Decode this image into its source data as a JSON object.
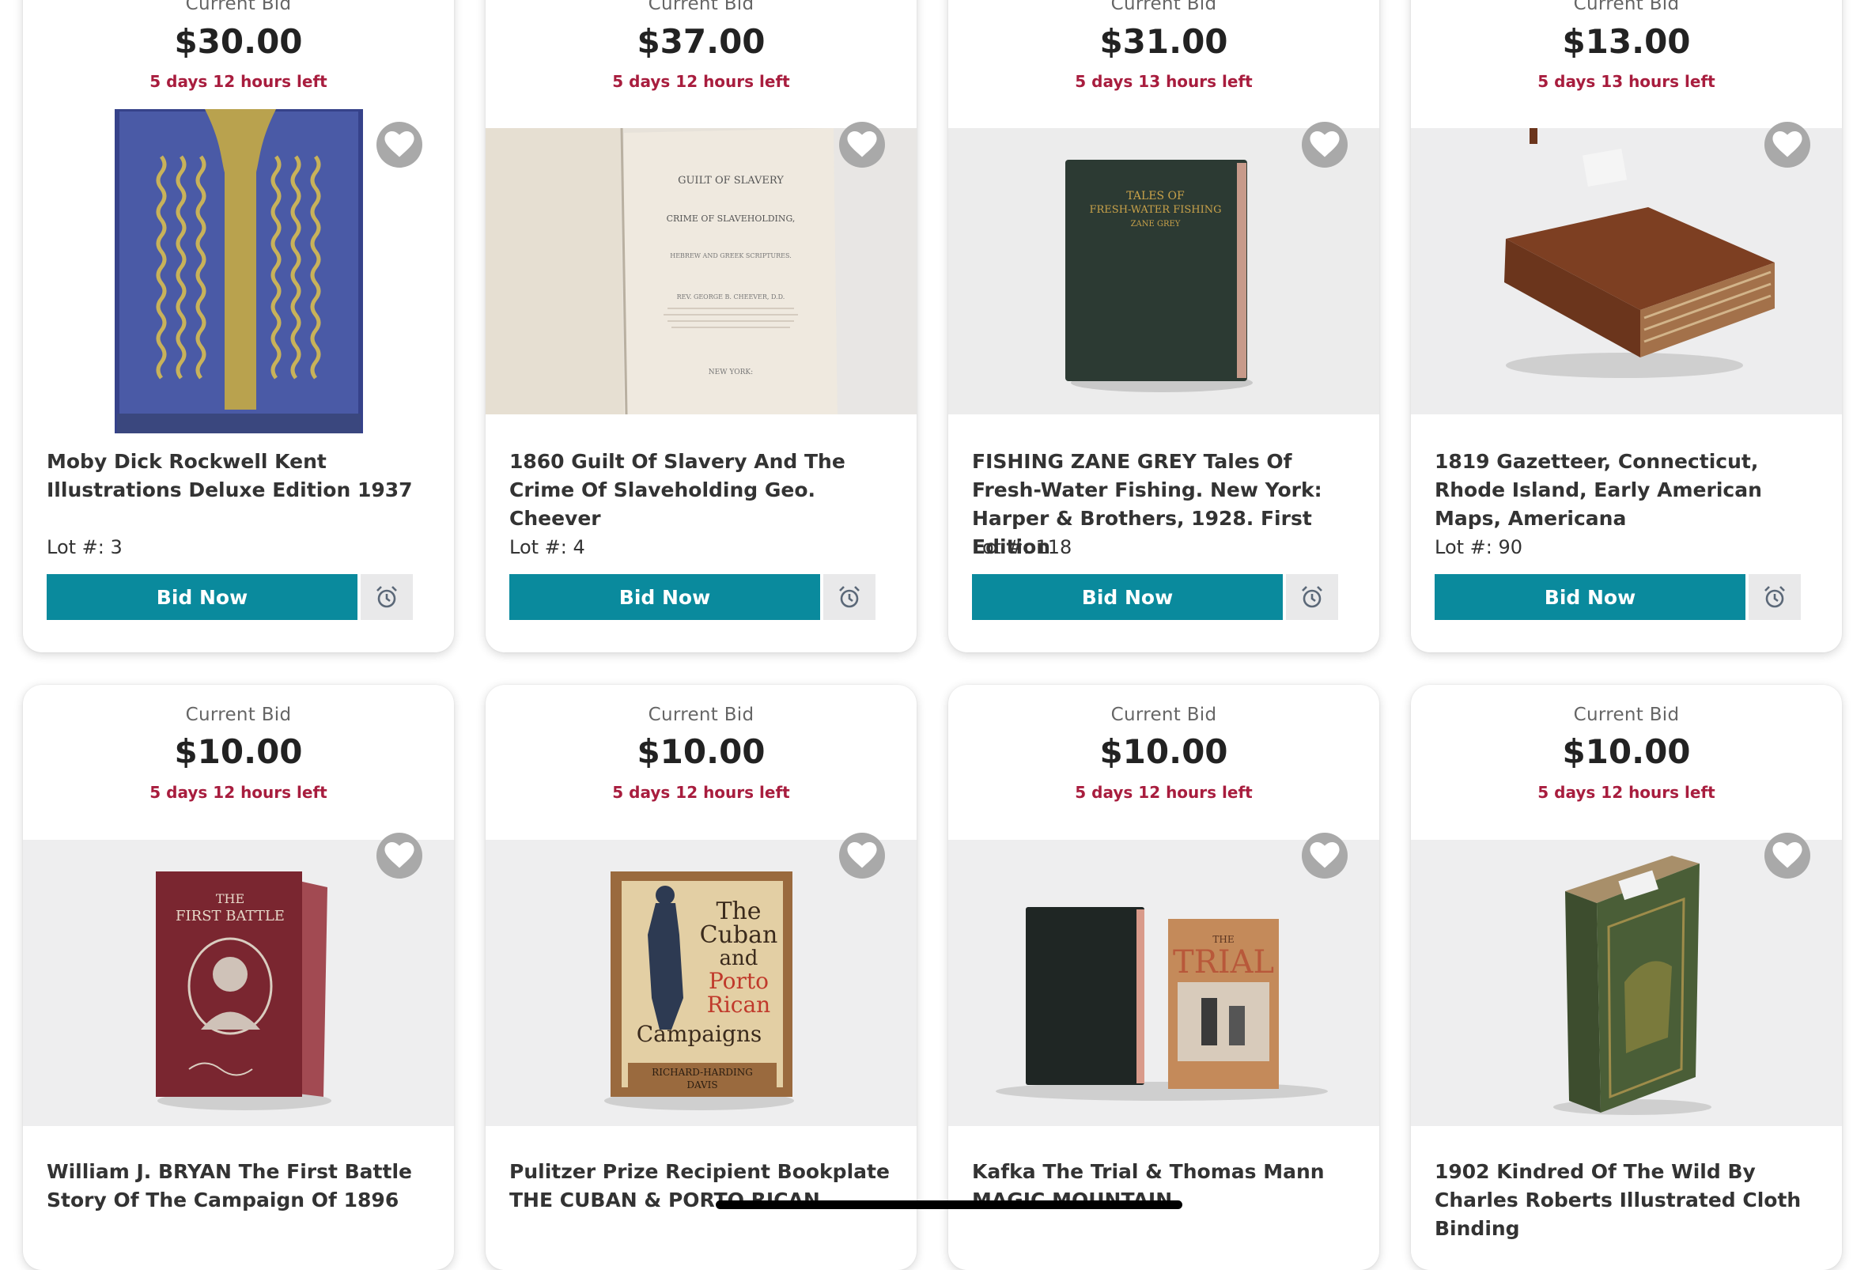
{
  "lots": [
    {
      "bid_label": "Current Bid",
      "price": "$30.00",
      "time_left": "5 days 12 hours left",
      "title": "Moby Dick Rockwell Kent Illustrations Deluxe Edition 1937",
      "lot": "Lot #: 3",
      "button": "Bid Now",
      "image": "blue-book-cover"
    },
    {
      "bid_label": "Current Bid",
      "price": "$37.00",
      "time_left": "5 days 12 hours left",
      "title": "1860 Guilt Of Slavery And The Crime Of Slaveholding Geo. Cheever",
      "lot": "Lot #: 4",
      "button": "Bid Now",
      "image": "open-book-title-page"
    },
    {
      "bid_label": "Current Bid",
      "price": "$31.00",
      "time_left": "5 days 13 hours left",
      "title": "FISHING ZANE GREY Tales Of Fresh-Water Fishing. New York: Harper & Brothers, 1928. First Edition",
      "lot": "Lot #: 118",
      "button": "Bid Now",
      "image": "green-book"
    },
    {
      "bid_label": "Current Bid",
      "price": "$13.00",
      "time_left": "5 days 13 hours left",
      "title": "1819 Gazetteer, Connecticut, Rhode Island, Early American Maps, Americana",
      "lot": "Lot #: 90",
      "button": "Bid Now",
      "image": "leather-book"
    },
    {
      "bid_label": "Current Bid",
      "price": "$10.00",
      "time_left": "5 days 12 hours left",
      "title": "William J. BRYAN The First Battle Story Of The Campaign Of 1896",
      "image": "red-book"
    },
    {
      "bid_label": "Current Bid",
      "price": "$10.00",
      "time_left": "5 days 12 hours left",
      "title": "Pulitzer Prize Recipient Bookplate THE CUBAN & PORTO RICAN",
      "image": "cuban-campaigns-book"
    },
    {
      "bid_label": "Current Bid",
      "price": "$10.00",
      "time_left": "5 days 12 hours left",
      "title": "Kafka The Trial & Thomas Mann MAGIC MOUNTAIN",
      "image": "two-books"
    },
    {
      "bid_label": "Current Bid",
      "price": "$10.00",
      "time_left": "5 days 12 hours left",
      "title": "1902 Kindred Of The Wild By Charles Roberts Illustrated Cloth Binding",
      "image": "green-cloth-book"
    }
  ],
  "book_text": {
    "guilt_title_1": "GUILT OF SLAVERY",
    "guilt_title_2": "CRIME OF SLAVEHOLDING,",
    "guilt_sub": "HEBREW AND GREEK SCRIPTURES.",
    "guilt_author": "REV. GEORGE B. CHEEVER, D.D.",
    "guilt_city": "NEW YORK:",
    "zane_1": "TALES OF",
    "zane_2": "FRESH-WATER FISHING",
    "zane_3": "ZANE GREY",
    "bryan_1": "THE",
    "bryan_2": "FIRST BATTLE",
    "cuban_1": "The",
    "cuban_2": "Cuban",
    "cuban_3": "and",
    "cuban_4": "Porto",
    "cuban_5": "Rican",
    "cuban_6": "Campaigns",
    "cuban_7": "RICHARD-HARDING",
    "cuban_8": "DAVIS",
    "trial_1": "THE",
    "trial_2": "TRIAL"
  },
  "colors": {
    "accent": "#0a8a9d",
    "time": "#a81d3e",
    "heart_bg": "#a9a9a9"
  }
}
